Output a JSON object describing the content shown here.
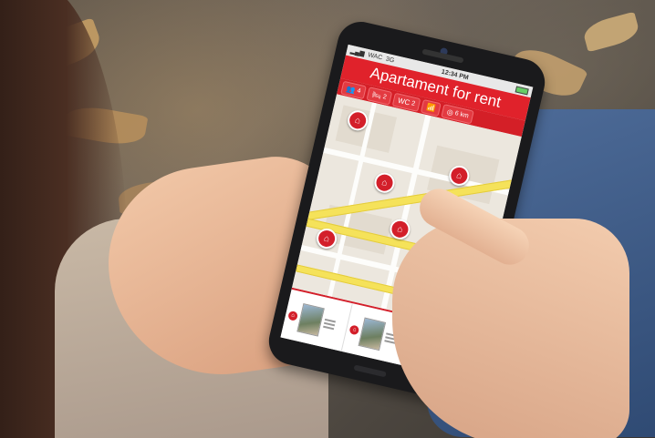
{
  "app": {
    "status": {
      "carrier": "WAC",
      "network": "3G",
      "time": "12:34 PM"
    },
    "title": "Apartament for rent",
    "filters": [
      {
        "icon": "people-icon",
        "glyph": "👥",
        "value": "4"
      },
      {
        "icon": "bed-icon",
        "glyph": "🛏",
        "value": "2"
      },
      {
        "icon": "wc-icon",
        "glyph": "WC",
        "value": "2"
      },
      {
        "icon": "wifi-icon",
        "glyph": "📶",
        "value": ""
      },
      {
        "icon": "distance-icon",
        "glyph": "◎",
        "value": "6 km"
      }
    ],
    "map": {
      "add_label": "+"
    },
    "listing_count": 3
  },
  "colors": {
    "accent": "#d31f2a",
    "road_major": "#f5e25a",
    "park": "#9fd58a"
  }
}
